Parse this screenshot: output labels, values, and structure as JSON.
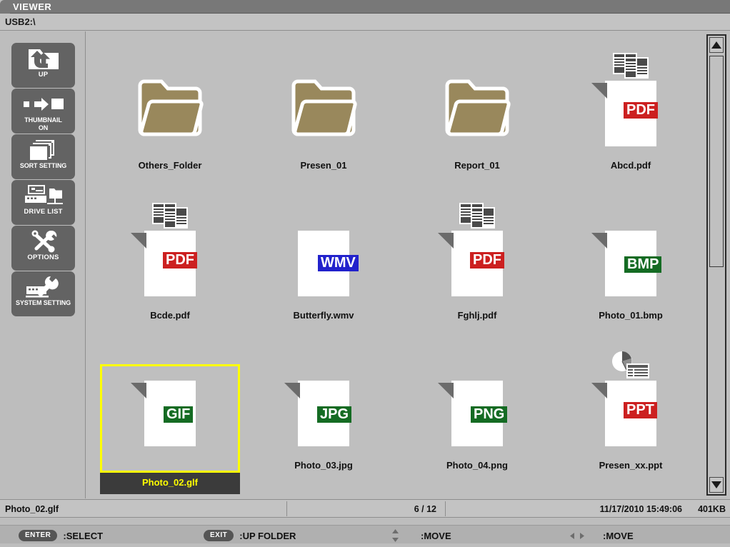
{
  "window": {
    "title": "VIEWER",
    "path": "USB2:\\"
  },
  "sidebar": {
    "items": [
      {
        "label": "UP",
        "icon": "folder-up-icon",
        "name": "sidebar-item-up"
      },
      {
        "label": "THUMBNAIL\nON",
        "icon": "thumbnail-icon",
        "name": "sidebar-item-thumbnail"
      },
      {
        "label": "SORT SETTING",
        "icon": "stacked-pages-icon",
        "name": "sidebar-item-sort-setting"
      },
      {
        "label": "DRIVE LIST",
        "icon": "drive-list-icon",
        "name": "sidebar-item-drive-list"
      },
      {
        "label": "OPTIONS",
        "icon": "tools-icon",
        "name": "sidebar-item-options"
      },
      {
        "label": "SYSTEM SETTING",
        "icon": "system-wrench-icon",
        "name": "sidebar-item-system-setting"
      }
    ]
  },
  "files": [
    {
      "name": "Others_Folder",
      "type": "folder",
      "badge": "",
      "selected": false
    },
    {
      "name": "Presen_01",
      "type": "folder",
      "badge": "",
      "selected": false
    },
    {
      "name": "Report_01",
      "type": "folder",
      "badge": "",
      "selected": false
    },
    {
      "name": "Abcd.pdf",
      "type": "pdf",
      "badge": "PDF",
      "selected": false
    },
    {
      "name": "Bcde.pdf",
      "type": "pdf",
      "badge": "PDF",
      "selected": false
    },
    {
      "name": "Butterfly.wmv",
      "type": "wmv",
      "badge": "WMV",
      "selected": false
    },
    {
      "name": "Fghlj.pdf",
      "type": "pdf",
      "badge": "PDF",
      "selected": false
    },
    {
      "name": "Photo_01.bmp",
      "type": "image",
      "badge": "BMP",
      "selected": false
    },
    {
      "name": "Photo_02.glf",
      "type": "image",
      "badge": "GIF",
      "selected": true
    },
    {
      "name": "Photo_03.jpg",
      "type": "image",
      "badge": "JPG",
      "selected": false
    },
    {
      "name": "Photo_04.png",
      "type": "image",
      "badge": "PNG",
      "selected": false
    },
    {
      "name": "Presen_xx.ppt",
      "type": "ppt",
      "badge": "PPT",
      "selected": false
    }
  ],
  "scrollbar": {
    "up_arrow": "triangle-up-icon",
    "down_arrow": "triangle-down-icon"
  },
  "statusbar": {
    "filename": "Photo_02.glf",
    "counter": "6 / 12",
    "datetime": "11/17/2010  15:49:06",
    "filesize": "401KB"
  },
  "keybar": {
    "items": [
      {
        "key": "ENTER",
        "glyph": "",
        "label": ":SELECT"
      },
      {
        "key": "EXIT",
        "glyph": "",
        "label": ":UP FOLDER"
      },
      {
        "key": "",
        "glyph": "updown",
        "label": ":MOVE"
      },
      {
        "key": "",
        "glyph": "leftright",
        "label": ":MOVE"
      }
    ]
  },
  "colors": {
    "folder": "#99885c",
    "selection": "#ffff00",
    "pdf_badge": "#cc2020",
    "image_badge": "#146b23",
    "video_badge": "#2222cc",
    "sidebar_button": "#636363"
  }
}
